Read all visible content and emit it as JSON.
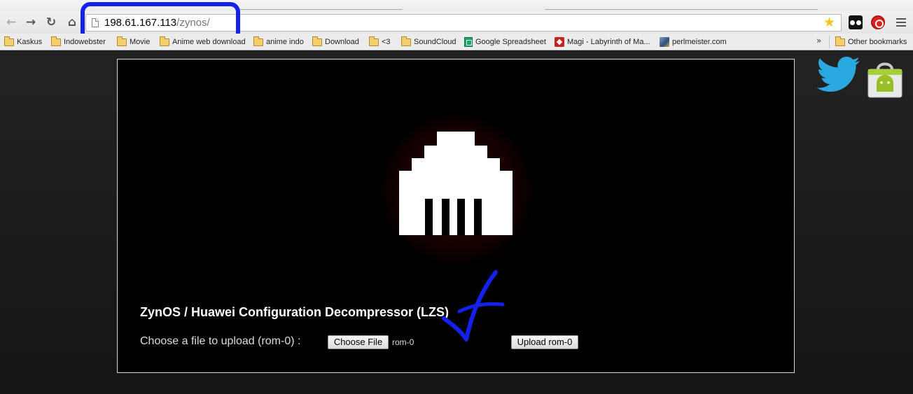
{
  "browser": {
    "url_host": "198.61.167.113",
    "url_path": "/zynos/",
    "nav": {
      "back_icon": "back-arrow-icon",
      "forward_icon": "forward-arrow-icon",
      "reload_icon": "reload-icon",
      "home_icon": "home-icon"
    },
    "bookmark_star_icon": "star-icon",
    "extensions": [
      "glasses-extension-icon",
      "stop-extension-icon"
    ],
    "menu_icon": "hamburger-menu-icon"
  },
  "bookmarks": {
    "items": [
      {
        "label": "Kaskus",
        "icon": "folder-icon"
      },
      {
        "label": "Indowebster",
        "icon": "folder-icon"
      },
      {
        "label": "Movie",
        "icon": "folder-icon"
      },
      {
        "label": "Anime web download",
        "icon": "folder-icon"
      },
      {
        "label": "anime indo",
        "icon": "folder-icon"
      },
      {
        "label": "Download",
        "icon": "folder-icon"
      },
      {
        "label": "<3",
        "icon": "folder-icon"
      },
      {
        "label": "SoundCloud",
        "icon": "folder-icon"
      },
      {
        "label": "Google Spreadsheet",
        "icon": "spreadsheet-icon"
      },
      {
        "label": "Magi - Labyrinth of Ma...",
        "icon": "game-icon"
      },
      {
        "label": "perlmeister.com",
        "icon": "site-icon"
      }
    ],
    "overflow_label": "»",
    "other_label": "Other bookmarks"
  },
  "page": {
    "title": "ZynOS / Huawei Configuration Decompressor (LZS)",
    "upload_label": "Choose a file to upload (rom-0) :",
    "choose_button": "Choose File",
    "selected_file": "rom-0",
    "upload_button": "Upload rom-0"
  },
  "colors": {
    "annotation": "#1321ea",
    "panel_bg": "#000000",
    "page_bg": "#1a1a1a"
  }
}
